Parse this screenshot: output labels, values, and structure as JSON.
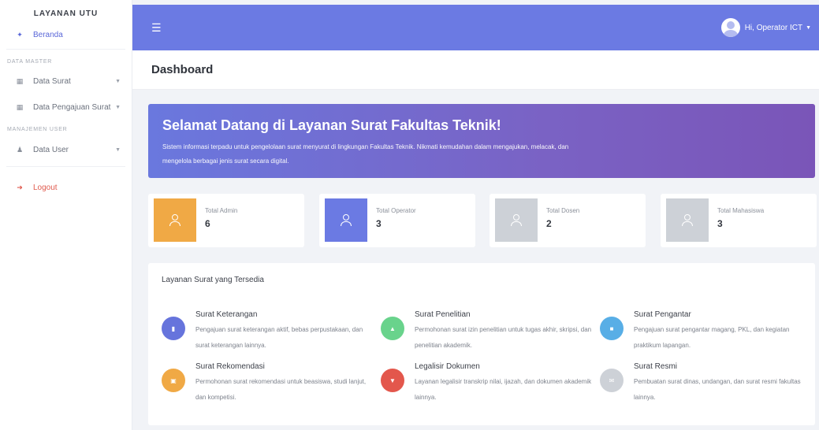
{
  "sidebar": {
    "brand": "LAYANAN UTU",
    "home": {
      "icon": "home-icon",
      "label": "Beranda"
    },
    "section_master": "DATA MASTER",
    "data_surat": {
      "icon": "grid-icon",
      "label": "Data Surat"
    },
    "data_pengajuan": {
      "icon": "grid-icon",
      "label": "Data Pengajuan Surat"
    },
    "section_user": "MANAJEMEN USER",
    "data_user": {
      "icon": "user-icon",
      "label": "Data User"
    },
    "logout": {
      "icon": "logout-icon",
      "label": "Logout"
    }
  },
  "topbar": {
    "menu_icon": "hamburger-icon",
    "user_label": "Hi, Operator ICT",
    "accent": "#6b7ae3"
  },
  "page": {
    "title": "Dashboard"
  },
  "hero": {
    "title": "Selamat Datang di Layanan Surat Fakultas Teknik!",
    "text": "Sistem informasi terpadu untuk pengelolaan surat menyurat di lingkungan Fakultas Teknik. Nikmati kemudahan dalam mengajukan, melacak, dan mengelola berbagai jenis surat secara digital."
  },
  "stats": [
    {
      "label": "Total Admin",
      "value": "6",
      "color": "#f0a945"
    },
    {
      "label": "Total Operator",
      "value": "3",
      "color": "#6b7ae3"
    },
    {
      "label": "Total Dosen",
      "value": "2",
      "color": "#cdd1d7"
    },
    {
      "label": "Total Mahasiswa",
      "value": "3",
      "color": "#cdd1d7"
    }
  ],
  "services": {
    "title": "Layanan Surat yang Tersedia",
    "items": [
      {
        "name": "Surat Keterangan",
        "desc": "Pengajuan surat keterangan aktif, bebas perpustakaan, dan surat keterangan lainnya.",
        "icon": "document-icon",
        "color": "#6674dc"
      },
      {
        "name": "Surat Penelitian",
        "desc": "Permohonan surat izin penelitian untuk tugas akhir, skripsi, dan penelitian akademik.",
        "icon": "graduation-cap-icon",
        "color": "#69d38c"
      },
      {
        "name": "Surat Pengantar",
        "desc": "Pengajuan surat pengantar magang, PKL, dan kegiatan praktikum lapangan.",
        "icon": "briefcase-icon",
        "color": "#58aee6"
      },
      {
        "name": "Surat Rekomendasi",
        "desc": "Permohonan surat rekomendasi untuk beasiswa, studi lanjut, dan kompetisi.",
        "icon": "certificate-icon",
        "color": "#f0a945"
      },
      {
        "name": "Legalisir Dokumen",
        "desc": "Layanan legalisir transkrip nilai, ijazah, dan dokumen akademik lainnya.",
        "icon": "stamp-icon",
        "color": "#e3574c"
      },
      {
        "name": "Surat Resmi",
        "desc": "Pembuatan surat dinas, undangan, dan surat resmi fakultas lainnya.",
        "icon": "envelope-icon",
        "color": "#cdd1d7"
      }
    ]
  }
}
